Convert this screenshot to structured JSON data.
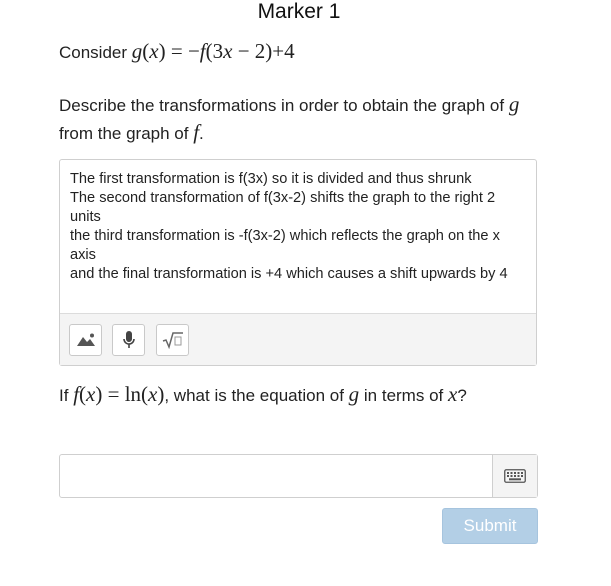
{
  "header": {
    "title": "Marker 1"
  },
  "question1": {
    "intro": "Consider",
    "function_expression": "g(x) = −f(3x − 2)+4"
  },
  "question2": {
    "text_before_g": "Describe the transformations in order to obtain the graph of",
    "g": "g",
    "text_middle": "from the graph of",
    "f": "f",
    "text_end": "."
  },
  "answer": {
    "lines": [
      "The first transformation is f(3x) so it is divided and thus shrunk",
      "The second transformation of f(3x-2) shifts the graph to the right 2 units",
      "the third transformation is -f(3x-2) which reflects the graph on the x axis",
      "and the final transformation is +4 which causes a shift upwards by 4"
    ]
  },
  "toolbar": {
    "buttons": [
      {
        "name": "image-upload",
        "icon": "image-icon"
      },
      {
        "name": "voice-input",
        "icon": "microphone-icon"
      },
      {
        "name": "math-input",
        "icon": "square-root-icon"
      }
    ]
  },
  "question3": {
    "text_if": "If",
    "given": "f(x) = ln(x)",
    "text_mid": ", what is the equation of",
    "g": "g",
    "text_terms": "in terms of",
    "x": "x",
    "text_end": "?"
  },
  "input": {
    "value": "",
    "placeholder": ""
  },
  "submit": {
    "label": "Submit"
  },
  "colors": {
    "submit_bg": "#b3cfe6",
    "border": "#cfcfcf",
    "toolbar_bg": "#f4f4f4"
  }
}
